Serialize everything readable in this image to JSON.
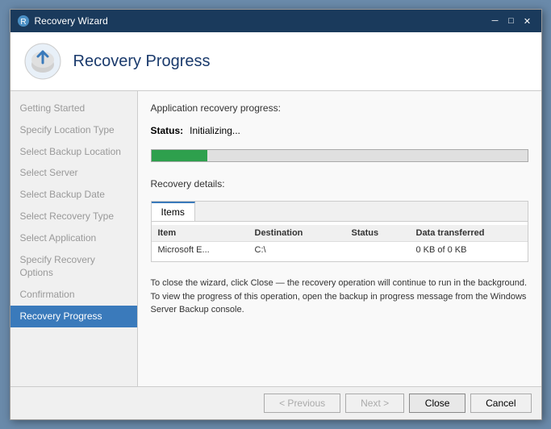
{
  "titleBar": {
    "icon": "recovery-wizard-icon",
    "text": "Recovery Wizard",
    "closeBtn": "✕",
    "minimizeBtn": "─",
    "maximizeBtn": "□"
  },
  "header": {
    "title": "Recovery Progress"
  },
  "sidebar": {
    "items": [
      {
        "id": "getting-started",
        "label": "Getting Started",
        "state": "normal"
      },
      {
        "id": "specify-location-type",
        "label": "Specify Location Type",
        "state": "normal"
      },
      {
        "id": "select-backup-location",
        "label": "Select Backup Location",
        "state": "normal"
      },
      {
        "id": "select-server",
        "label": "Select Server",
        "state": "normal"
      },
      {
        "id": "select-backup-date",
        "label": "Select Backup Date",
        "state": "normal"
      },
      {
        "id": "select-recovery-type",
        "label": "Select Recovery Type",
        "state": "normal"
      },
      {
        "id": "select-application",
        "label": "Select Application",
        "state": "normal"
      },
      {
        "id": "specify-recovery-options",
        "label": "Specify Recovery Options",
        "state": "normal"
      },
      {
        "id": "confirmation",
        "label": "Confirmation",
        "state": "normal"
      },
      {
        "id": "recovery-progress",
        "label": "Recovery Progress",
        "state": "active"
      }
    ]
  },
  "main": {
    "progressSection": {
      "label": "Application recovery progress:",
      "statusLabel": "Status:",
      "statusValue": "Initializing...",
      "progressPercent": 15
    },
    "recoveryDetails": {
      "label": "Recovery details:",
      "tab": "Items",
      "tableHeaders": [
        "Item",
        "Destination",
        "Status",
        "Data transferred"
      ],
      "tableRows": [
        {
          "item": "Microsoft E...",
          "destination": "C:\\",
          "status": "",
          "dataTransferred": "0 KB of 0 KB"
        }
      ]
    },
    "infoText1": "To close the wizard, click Close — the recovery operation will continue to run in the background.",
    "infoText2": "To view the progress of this operation, open the backup in progress message from the Windows Server Backup console."
  },
  "footer": {
    "previousLabel": "< Previous",
    "nextLabel": "Next >",
    "closeLabel": "Close",
    "cancelLabel": "Cancel"
  }
}
